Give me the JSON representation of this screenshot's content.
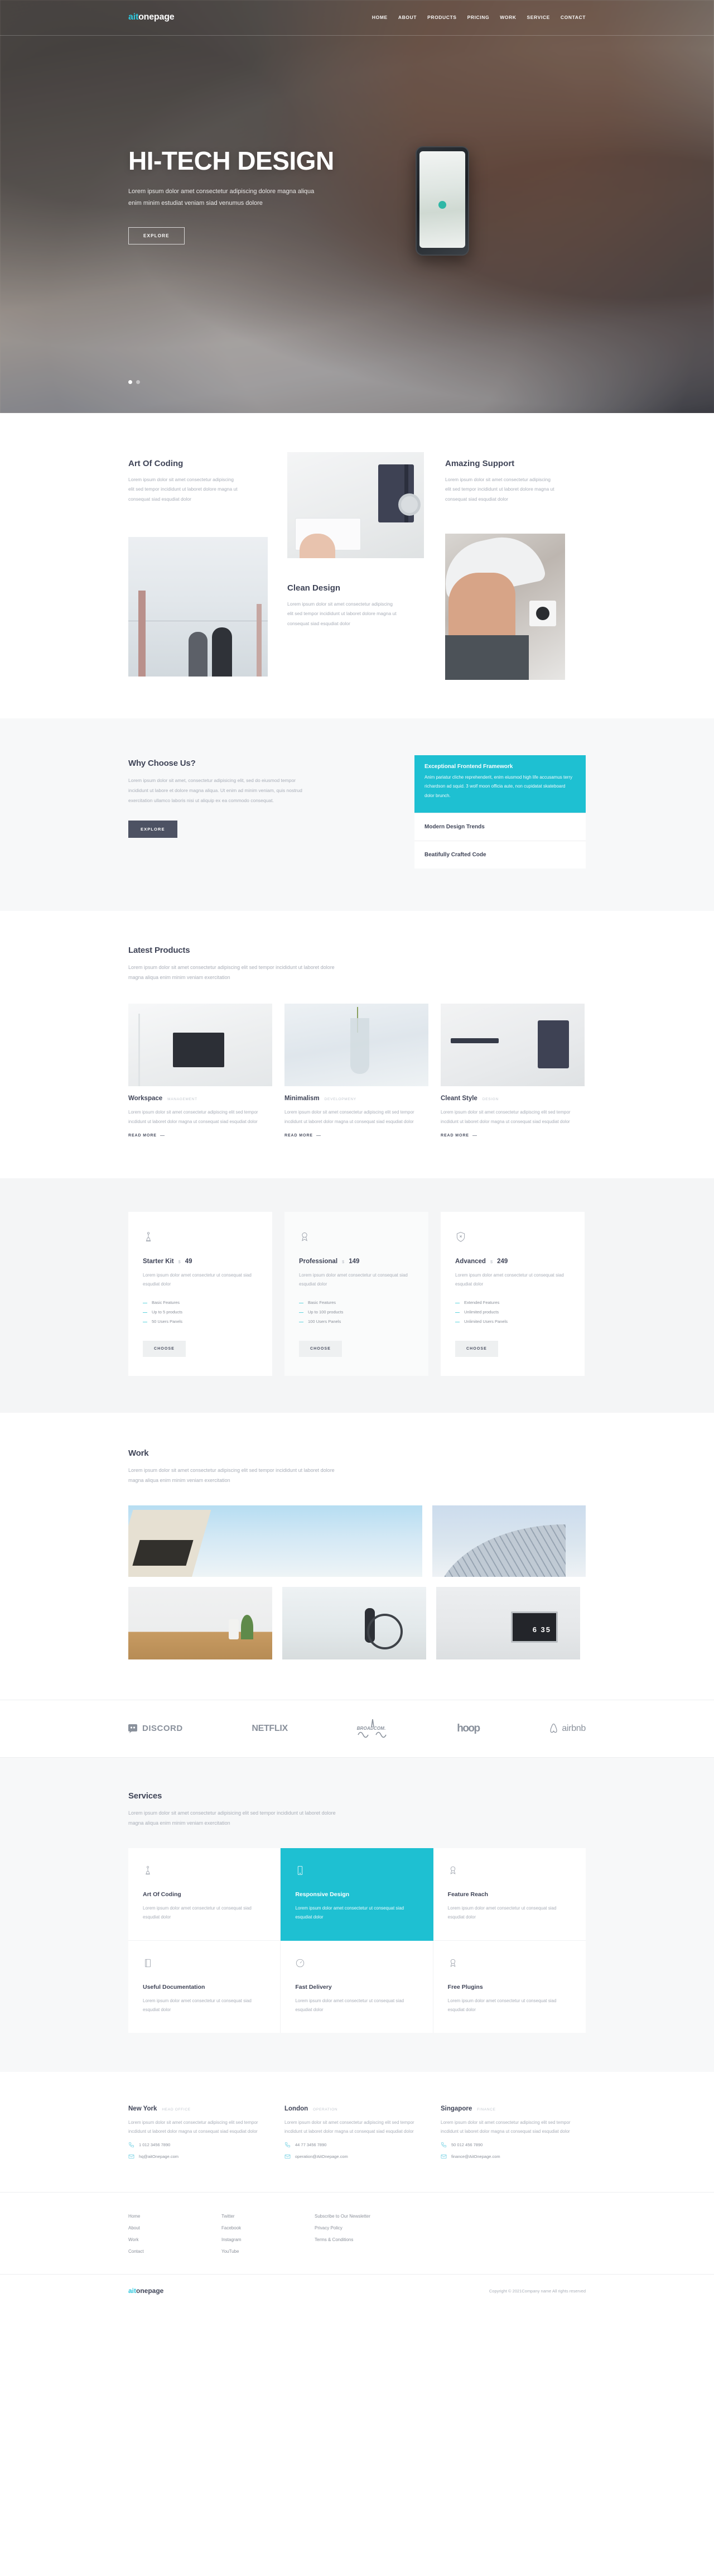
{
  "brand": {
    "part1": "ait",
    "part2": "onepage"
  },
  "nav": {
    "items": [
      "HOME",
      "ABOUT",
      "PRODUCTS",
      "PRICING",
      "WORK",
      "SERVICE",
      "CONTACT"
    ]
  },
  "hero": {
    "title": "HI-TECH DESIGN",
    "subtitle": "Lorem ipsum dolor amet consectetur adipiscing dolore magna aliqua enim minim estudiat veniam siad venumus dolore",
    "button": "EXPLORE"
  },
  "features": {
    "art": {
      "title": "Art Of Coding",
      "text": "Lorem ipsum dolor sit amet consectetur adipiscing elit sed tempor incididunt ut laboret dolore magna ut consequat siad esqudiat dolor"
    },
    "clean": {
      "title": "Clean Design",
      "text": "Lorem ipsum dolor sit amet consectetur adipiscing elit sed tempor incididunt ut laboret dolore magna ut consequat siad esqudiat dolor"
    },
    "support": {
      "title": "Amazing Support",
      "text": "Lorem ipsum dolor sit amet consectetur adipiscing elit sed tempor incididunt ut laboret dolore magna ut consequat siad esqudiat dolor"
    }
  },
  "why": {
    "title": "Why Choose Us?",
    "text": "Lorem ipsum dolor sit amet, consectetur adipisicing elit, sed do eiusmod tempor incididunt ut labore et dolore magna aliqua. Ut enim ad minim veniam, quis nostrud exercitation ullamco laboris nisi ut aliquip ex ea commodo consequat.",
    "button": "EXPLORE",
    "accordion": [
      {
        "title": "Exceptional Frontend Framework",
        "body": "Anim pariatur cliche reprehenderit, enim eiusmod high life accusamus terry richardson ad squid. 3 wolf moon officia aute, non cupidatat skateboard dolor brunch.",
        "active": true
      },
      {
        "title": "Modern Design Trends",
        "body": "",
        "active": false
      },
      {
        "title": "Beatifully Crafted Code",
        "body": "",
        "active": false
      }
    ]
  },
  "products": {
    "title": "Latest Products",
    "lead": "Lorem ipsum dolor sit amet consectetur adipiscing elit sed tempor incididunt ut laboret dolore magna aliqua enim minim veniam exercitation",
    "items": [
      {
        "name": "Workspace",
        "tag": "MANAGEMENT",
        "desc": "Lorem ipsum dolor sit amet consectetur adipiscing elit sed tempor incdidunt ut laboret dolor magna ut consequat siad esqudiat dolor",
        "more": "READ MORE"
      },
      {
        "name": "Minimalism",
        "tag": "DEVELOPMENY",
        "desc": "Lorem ipsum dolor sit amet consectetur adipiscing elit sed tempor incdidunt ut laboret dolor magna ut consequat siad esqudiat dolor",
        "more": "READ MORE"
      },
      {
        "name": "Cleant Style",
        "tag": "DESIGN",
        "desc": "Lorem ipsum dolor sit amet consectetur adipiscing elit sed tempor incdidunt ut laboret dolor magna ut consequat siad esqudiat dolor",
        "more": "READ MORE"
      }
    ]
  },
  "pricing": {
    "plans": [
      {
        "name": "Starter Kit",
        "currency": "$",
        "amount": "49",
        "desc": "Lorem ipsum dolor amet consectetur ut consequat siad esqudiat dolor",
        "features": [
          "Basic Features",
          "Up to 5 products",
          "50 Users Panels"
        ],
        "button": "CHOOSE",
        "icon": "chess-pawn-icon"
      },
      {
        "name": "Professional",
        "currency": "$",
        "amount": "149",
        "desc": "Lorem ipsum dolor amet consectetur ut consequat siad esqudiat dolor",
        "features": [
          "Basic Features",
          "Up to 100 products",
          "100 Users Panels"
        ],
        "button": "CHOOSE",
        "icon": "award-ribbon-icon"
      },
      {
        "name": "Advanced",
        "currency": "$",
        "amount": "249",
        "desc": "Lorem ipsum dolor amet consectetur ut consequat siad esqudiat dolor",
        "features": [
          "Extended Features",
          "Unlimited products",
          "Unlimited Users Panels"
        ],
        "button": "CHOOSE",
        "icon": "shield-close-icon"
      }
    ]
  },
  "work": {
    "title": "Work",
    "lead": "Lorem ipsum dolor sit amet consectetur adipiscing elit sed tempor incididunt ut laboret dolore magna aliqua enim minim veniam exercitation",
    "clock": "6 35"
  },
  "brands": {
    "items": [
      "DISCORD",
      "NETFLIX",
      "BROADCOM.",
      "hoop",
      "airbnb"
    ]
  },
  "services": {
    "title": "Services",
    "lead": "Lorem ipsum dolor sit amet consectetur adipisicing elit sed tempor incididunt ut laboret dolore magna aliqua enim minim veniam exercitation",
    "items": [
      {
        "title": "Art Of Coding",
        "text": "Lorem ipsum dolor amet consectetur ut consequat siad esqudiat dolor",
        "icon": "chess-pawn-icon",
        "highlight": false
      },
      {
        "title": "Responsive Design",
        "text": "Lorem ipsum dolor amet consectetur ut consequat siad esqudiat dolor",
        "icon": "mobile-icon",
        "highlight": true
      },
      {
        "title": "Feature Reach",
        "text": "Lorem ipsum dolor amet consectetur ut consequat siad esqudiat dolor",
        "icon": "award-ribbon-icon",
        "highlight": false
      },
      {
        "title": "Useful Documentation",
        "text": "Lorem ipsum dolor amet consectetur ut consequat siad esqudiat dolor",
        "icon": "document-icon",
        "highlight": false
      },
      {
        "title": "Fast Delivery",
        "text": "Lorem ipsum dolor amet consectetur ut consequat siad esqudiat dolor",
        "icon": "speedometer-icon",
        "highlight": false
      },
      {
        "title": "Free Plugins",
        "text": "Lorem ipsum dolor amet consectetur ut consequat siad esqudiat dolor",
        "icon": "award-ribbon-icon",
        "highlight": false
      }
    ]
  },
  "offices": [
    {
      "city": "New York",
      "role": "HEAD OFFICE",
      "desc": "Lorem ipsum dolor sit amet consectetur adipiscing elit sed tempor incdidunt ut laboret dolor magna ut consequat siad esqudiat dolor",
      "phone": "1 012 3456 7890",
      "email": "hq@aitOnepage.com"
    },
    {
      "city": "London",
      "role": "OPERATION",
      "desc": "Lorem ipsum dolor sit amet consectetur adipiscing elit sed tempor incdidunt ut laboret dolor magna ut consequat siad esqudiat dolor",
      "phone": "44 77 3456 7890",
      "email": "operation@AitOnepage.com"
    },
    {
      "city": "Singapore",
      "role": "FINANCE",
      "desc": "Lorem ipsum dolor sit amet consectetur adipiscing elit sed tempor incdidunt ut laboret dolor magna ut consequat siad esqudiat dolor",
      "phone": "50 012 456 7890",
      "email": "finance@AitOnepage.com"
    }
  ],
  "footer": {
    "col1": [
      "Home",
      "About",
      "Work",
      "Contact"
    ],
    "col2": [
      "Twitter",
      "Facebook",
      "Instagram",
      "YouTube"
    ],
    "col3": [
      "Subscribe to Our Newsletter",
      "Privacy Policy",
      "Terms & Conditions"
    ],
    "copyright": "Copyright © 2021Company name All rights reserved"
  },
  "colors": {
    "accent": "#1ec0d2",
    "logo_accent": "#2ec7dd",
    "dark": "#3f4457",
    "muted": "#a9aeb8"
  }
}
